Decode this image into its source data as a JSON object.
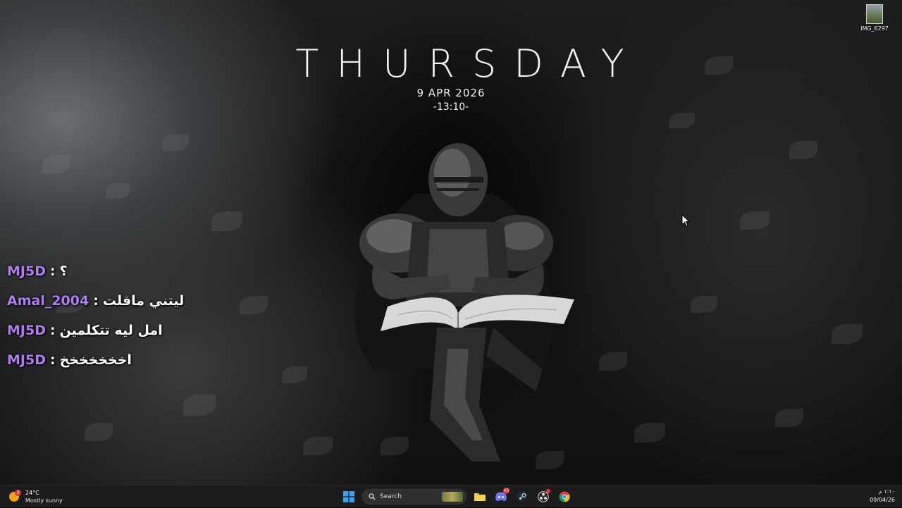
{
  "clock_widget": {
    "day": "THURSDAY",
    "date": "9 APR 2026",
    "time": "-13:10-"
  },
  "desktop_icons": [
    {
      "label": "IMG_6297"
    }
  ],
  "chat": [
    {
      "user": "MJ5D",
      "separator": ":",
      "message": "؟"
    },
    {
      "user": "Amal_2004",
      "separator": ":",
      "message": "ليتني ماقلت"
    },
    {
      "user": "MJ5D",
      "separator": ":",
      "message": "امل ليه تتكلمين"
    },
    {
      "user": "MJ5D",
      "separator": ":",
      "message": "اخخخخخخخ"
    }
  ],
  "taskbar": {
    "weather": {
      "temperature": "24°C",
      "condition": "Mostly sunny",
      "badge": "2"
    },
    "search": {
      "placeholder": "Search"
    },
    "apps": [
      {
        "name": "start",
        "icon": "windows-icon"
      },
      {
        "name": "file-explorer",
        "icon": "folder-icon"
      },
      {
        "name": "discord",
        "icon": "discord-icon",
        "badge": "43"
      },
      {
        "name": "steam",
        "icon": "steam-icon"
      },
      {
        "name": "obs",
        "icon": "obs-icon"
      },
      {
        "name": "chrome",
        "icon": "chrome-icon"
      }
    ],
    "clock": {
      "time": "١:١٠ م",
      "date": "09/04/26"
    }
  },
  "colors": {
    "chat_username": "#b07cf0",
    "taskbar_bg": "#1c1c1c",
    "accent_blue": "#3aa0f0"
  }
}
